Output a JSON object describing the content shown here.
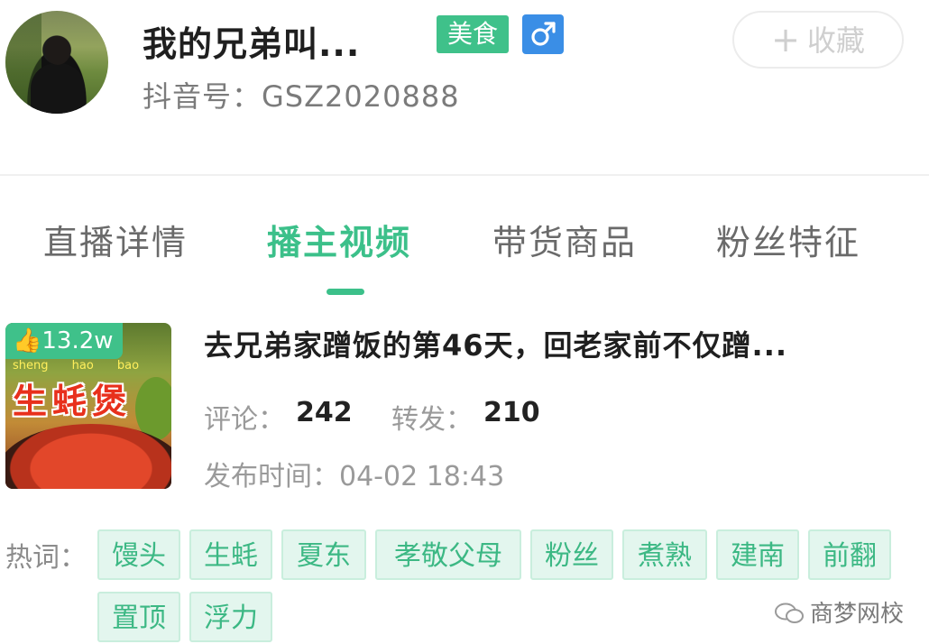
{
  "profile": {
    "name": "我的兄弟叫...",
    "category_badge": "美食",
    "gender_icon": "male-icon",
    "douyin_id": "抖音号：GSZ2020888",
    "favorite_label": "收藏",
    "favorite_icon": "plus-icon"
  },
  "tabs": [
    {
      "label": "直播详情",
      "active": false
    },
    {
      "label": "播主视频",
      "active": true
    },
    {
      "label": "带货商品",
      "active": false
    },
    {
      "label": "粉丝特征",
      "active": false
    }
  ],
  "video": {
    "likes": "13.2w",
    "like_icon": "thumbs-up-icon",
    "thumbnail_pinyin": "sheng hao bao",
    "thumbnail_text": "生蚝煲",
    "title": "去兄弟家蹭饭的第46天，回老家前不仅蹭...",
    "comments_label": "评论：",
    "comments_value": "242",
    "shares_label": "转发：",
    "shares_value": "210",
    "publish_time": "发布时间：04-02 18:43"
  },
  "hot_words": {
    "label": "热词：",
    "items": [
      "馒头",
      "生蚝",
      "夏东",
      "孝敬父母",
      "粉丝",
      "煮熟",
      "建南",
      "前翻",
      "置顶",
      "浮力"
    ]
  },
  "watermark": "商梦网校",
  "colors": {
    "accent_green": "#3cc08a",
    "chip_bg": "#e3f6ee",
    "gender_blue": "#3a8ee6"
  }
}
